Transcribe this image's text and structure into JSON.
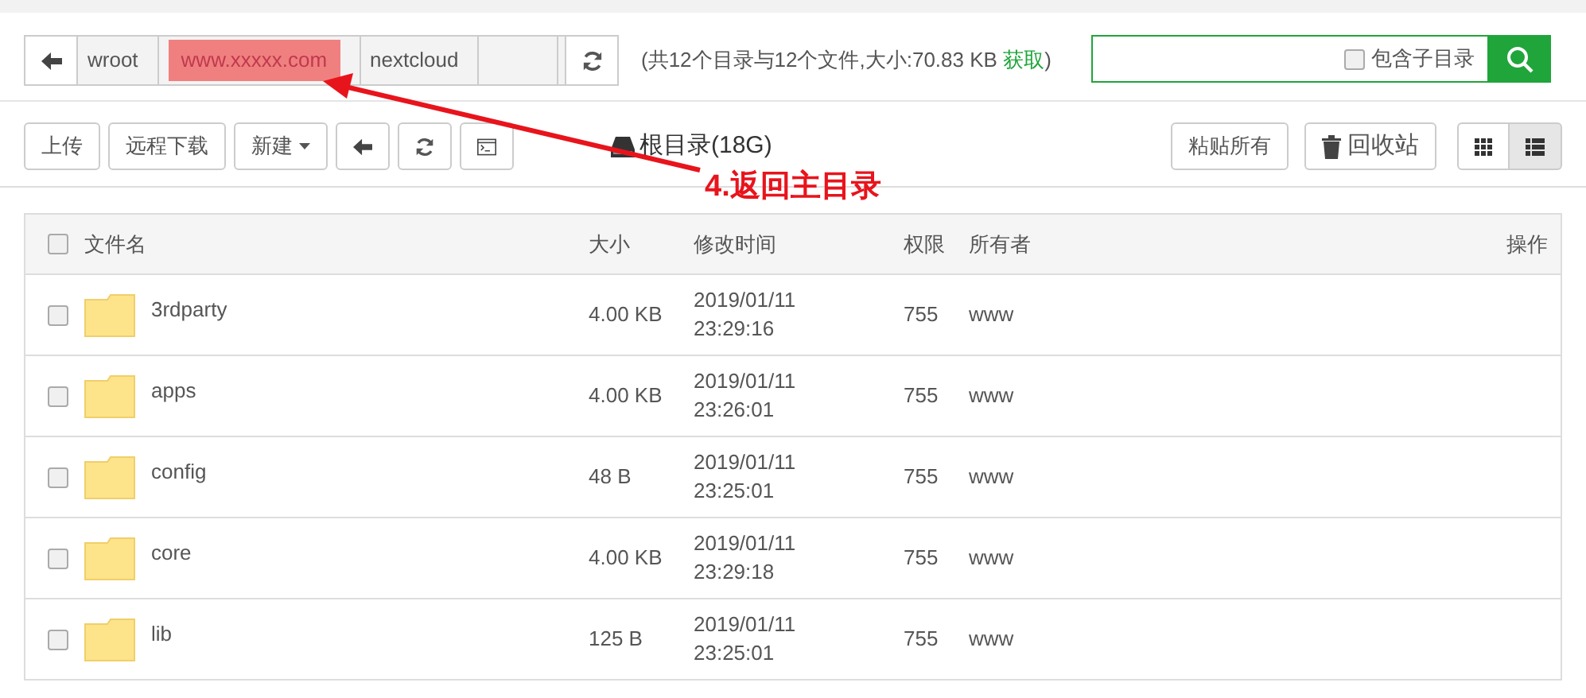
{
  "breadcrumb": {
    "crumbs": [
      {
        "label": "wroot",
        "highlighted": false
      },
      {
        "label": "www.xxxxx.com",
        "highlighted": true
      },
      {
        "label": "nextcloud",
        "highlighted": false
      }
    ]
  },
  "info": {
    "before": "(共12个目录与12个文件,大小:70.83 KB ",
    "link": "获取",
    "after": ")"
  },
  "search": {
    "include_subdirs_label": "包含子目录",
    "include_subdirs_checked": false
  },
  "toolbar": {
    "buttons": [
      {
        "kind": "text",
        "label": "上传"
      },
      {
        "kind": "text",
        "label": "远程下载"
      },
      {
        "kind": "dropdown",
        "label": "新建"
      },
      {
        "kind": "back"
      },
      {
        "kind": "refresh"
      },
      {
        "kind": "terminal"
      }
    ],
    "disk_label": "根目录(18G)",
    "paste_label": "粘贴所有",
    "recycle_label": "回收站",
    "views": [
      {
        "kind": "grid",
        "selected": false
      },
      {
        "kind": "list",
        "selected": true
      }
    ]
  },
  "annotation": {
    "label": "4.返回主目录"
  },
  "table": {
    "select_all_checked": false,
    "columns": [
      "文件名",
      "大小",
      "修改时间",
      "权限",
      "所有者",
      "操作"
    ],
    "rows": [
      {
        "name": "3rdparty",
        "size": "4.00 KB",
        "date": "2019/01/11",
        "time": "23:29:16",
        "perm": "755",
        "owner": "www",
        "checked": false
      },
      {
        "name": "apps",
        "size": "4.00 KB",
        "date": "2019/01/11",
        "time": "23:26:01",
        "perm": "755",
        "owner": "www",
        "checked": false
      },
      {
        "name": "config",
        "size": "48 B",
        "date": "2019/01/11",
        "time": "23:25:01",
        "perm": "755",
        "owner": "www",
        "checked": false
      },
      {
        "name": "core",
        "size": "4.00 KB",
        "date": "2019/01/11",
        "time": "23:29:18",
        "perm": "755",
        "owner": "www",
        "checked": false
      },
      {
        "name": "lib",
        "size": "125 B",
        "date": "2019/01/11",
        "time": "23:25:01",
        "perm": "755",
        "owner": "www",
        "checked": false
      }
    ]
  }
}
